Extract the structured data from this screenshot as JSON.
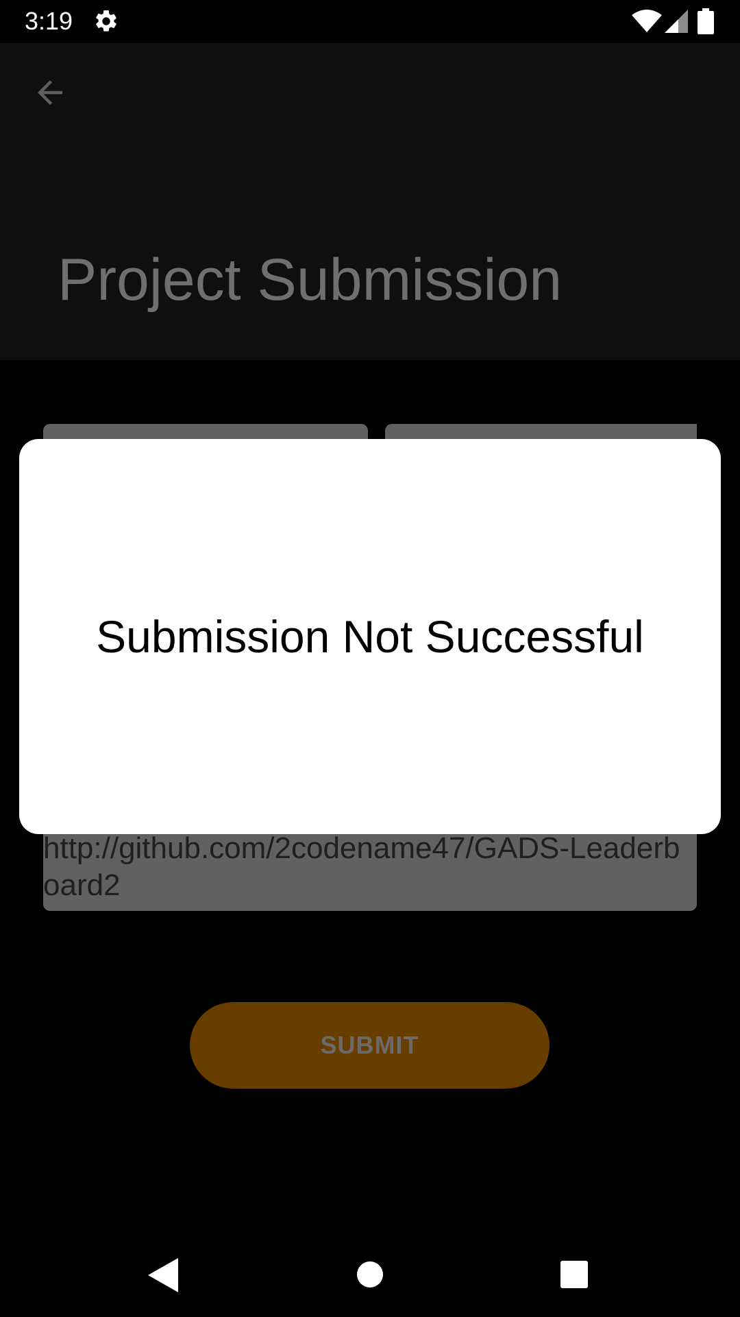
{
  "status_bar": {
    "time": "3:19",
    "icons": [
      "gear-icon",
      "wifi-icon",
      "signal-icon",
      "battery-icon"
    ]
  },
  "app_bar": {
    "back_icon": "arrow-left-icon",
    "title": "Project Submission"
  },
  "form": {
    "github_link": "http://github.com/2codename47/GADS-Leaderboard2",
    "submit_label": "SUBMIT"
  },
  "dialog": {
    "message": "Submission Not Successful"
  },
  "nav_bar": {
    "icons": [
      "back-triangle-icon",
      "home-circle-icon",
      "recents-square-icon"
    ]
  },
  "colors": {
    "background": "#000000",
    "app_bar_dimmed": "#0f0f0f",
    "title_dimmed": "#6f6f6f",
    "field_dimmed": "#616161",
    "submit_dimmed": "#673d00",
    "dialog_bg": "#ffffff"
  }
}
